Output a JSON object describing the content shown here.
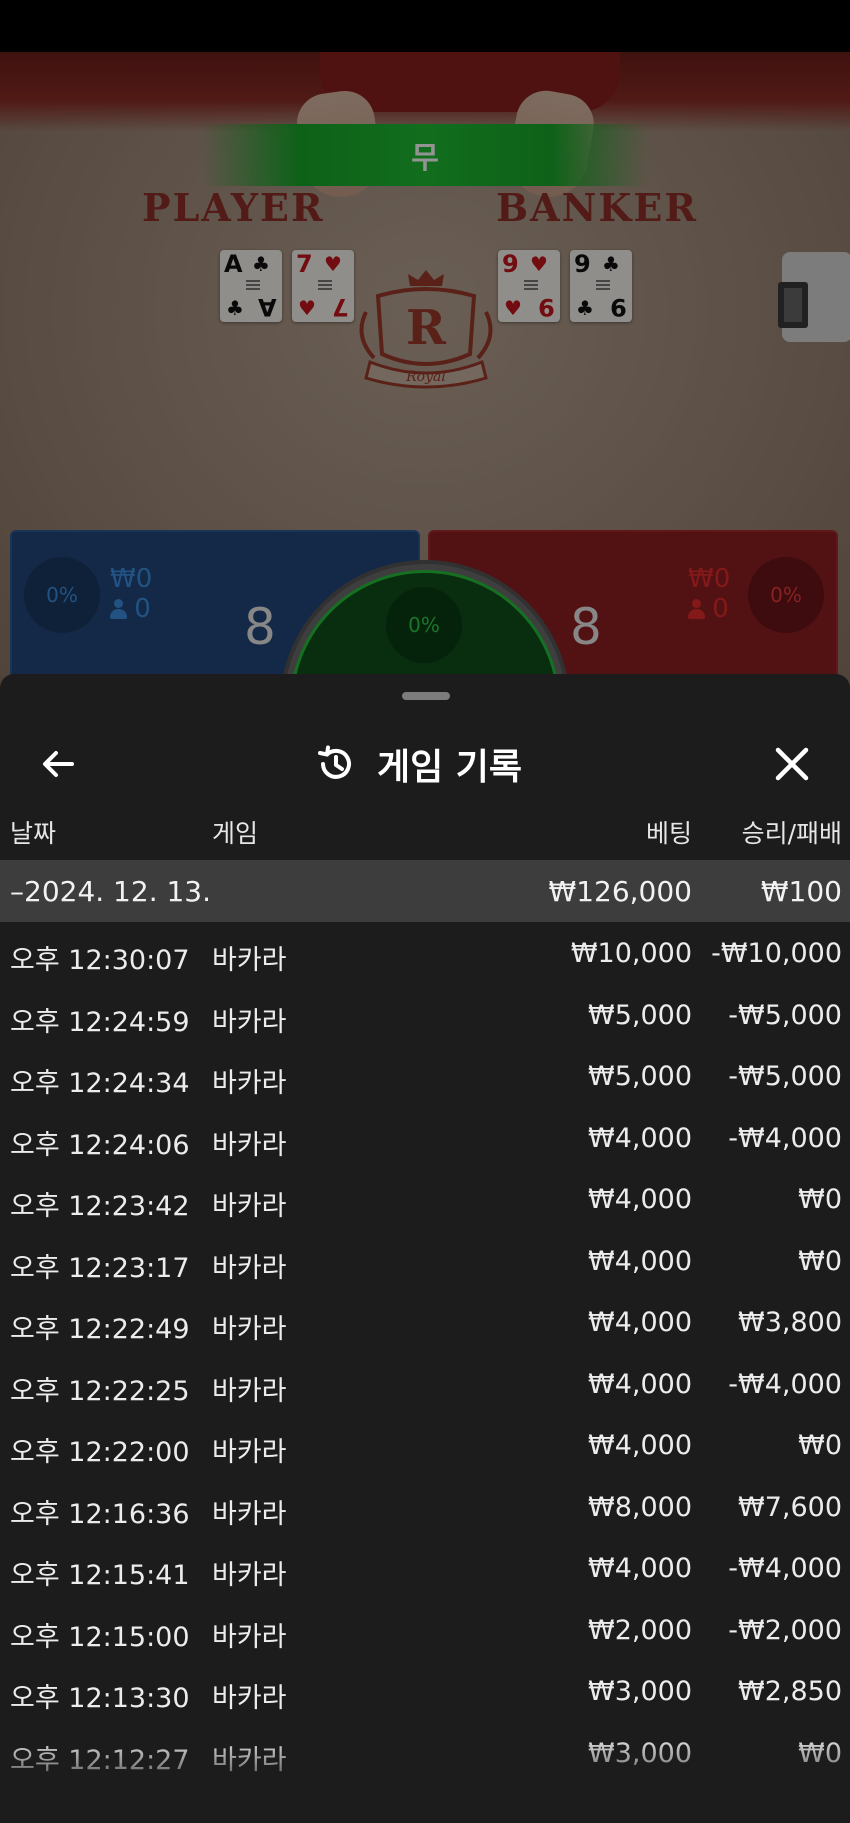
{
  "game": {
    "result_label": "무",
    "player_label": "PLAYER",
    "banker_label": "BANKER",
    "player_cards": [
      {
        "rank": "A",
        "suit": "♣",
        "color": "black"
      },
      {
        "rank": "7",
        "suit": "♥",
        "color": "red"
      }
    ],
    "banker_cards": [
      {
        "rank": "9",
        "suit": "♥",
        "color": "red"
      },
      {
        "rank": "9",
        "suit": "♣",
        "color": "black"
      }
    ],
    "emblem_letter": "R",
    "emblem_text": "Royal",
    "player": {
      "percent": "0%",
      "amount": "₩0",
      "users": "0",
      "score": "8"
    },
    "banker": {
      "percent": "0%",
      "amount": "₩0",
      "users": "0",
      "score": "8"
    },
    "tie": {
      "percent": "0%"
    },
    "colors": {
      "player": "#3b8de0",
      "banker": "#e22b2b",
      "tie": "#31c947"
    }
  },
  "history": {
    "title": "게임 기록",
    "icons": {
      "back": "arrow-left-icon",
      "title": "history-icon",
      "close": "close-icon"
    },
    "columns": {
      "date": "날짜",
      "game": "게임",
      "bet": "베팅",
      "result": "승리/패배"
    },
    "date_group": {
      "date": "–2024. 12. 13.",
      "bet": "₩126,000",
      "result": "₩100"
    },
    "rows": [
      {
        "time": "오후 12:30:07",
        "game": "바카라",
        "bet": "₩10,000",
        "result": "-₩10,000"
      },
      {
        "time": "오후 12:24:59",
        "game": "바카라",
        "bet": "₩5,000",
        "result": "-₩5,000"
      },
      {
        "time": "오후 12:24:34",
        "game": "바카라",
        "bet": "₩5,000",
        "result": "-₩5,000"
      },
      {
        "time": "오후 12:24:06",
        "game": "바카라",
        "bet": "₩4,000",
        "result": "-₩4,000"
      },
      {
        "time": "오후 12:23:42",
        "game": "바카라",
        "bet": "₩4,000",
        "result": "₩0"
      },
      {
        "time": "오후 12:23:17",
        "game": "바카라",
        "bet": "₩4,000",
        "result": "₩0"
      },
      {
        "time": "오후 12:22:49",
        "game": "바카라",
        "bet": "₩4,000",
        "result": "₩3,800"
      },
      {
        "time": "오후 12:22:25",
        "game": "바카라",
        "bet": "₩4,000",
        "result": "-₩4,000"
      },
      {
        "time": "오후 12:22:00",
        "game": "바카라",
        "bet": "₩4,000",
        "result": "₩0"
      },
      {
        "time": "오후 12:16:36",
        "game": "바카라",
        "bet": "₩8,000",
        "result": "₩7,600"
      },
      {
        "time": "오후 12:15:41",
        "game": "바카라",
        "bet": "₩4,000",
        "result": "-₩4,000"
      },
      {
        "time": "오후 12:15:00",
        "game": "바카라",
        "bet": "₩2,000",
        "result": "-₩2,000"
      },
      {
        "time": "오후 12:13:30",
        "game": "바카라",
        "bet": "₩3,000",
        "result": "₩2,850"
      },
      {
        "time": "오후 12:12:27",
        "game": "바카라",
        "bet": "₩3,000",
        "result": "₩0"
      }
    ]
  }
}
